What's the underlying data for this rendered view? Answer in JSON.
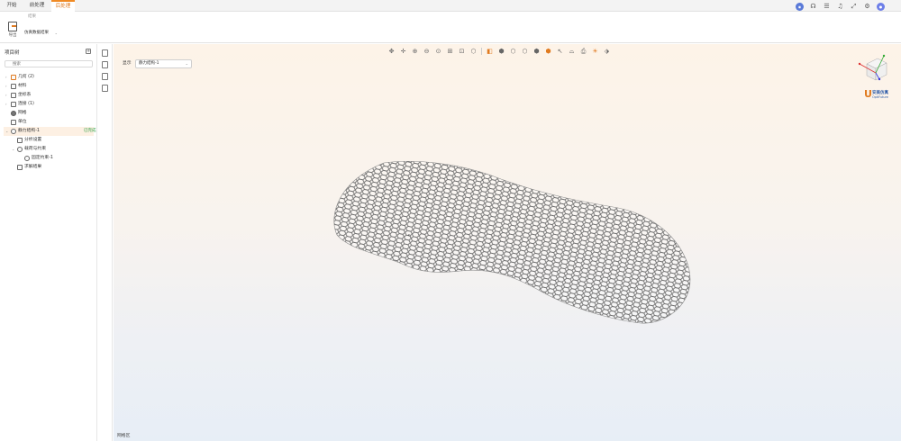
{
  "menu": {
    "tabs": [
      {
        "label": "开始",
        "active": false
      },
      {
        "label": "前处理",
        "active": false
      },
      {
        "label": "后处理",
        "active": true
      }
    ]
  },
  "top_icons": [
    "assistant-icon",
    "headset-icon",
    "list-icon",
    "bell-icon",
    "fullscreen-icon",
    "gear-icon",
    "avatar"
  ],
  "ribbon": {
    "group_label": "结果",
    "export_label": "导出",
    "select_value": "仿真数据结果"
  },
  "tree": {
    "title": "项目树",
    "search_placeholder": "搜索",
    "items": [
      {
        "label": "几何 (2)",
        "level": 0,
        "arrow": "›",
        "icon": "geometry-icon"
      },
      {
        "label": "材料",
        "level": 0,
        "arrow": "›",
        "icon": "material-icon"
      },
      {
        "label": "坐标系",
        "level": 0,
        "arrow": "›",
        "icon": "coordinate-icon"
      },
      {
        "label": "连接 (1)",
        "level": 0,
        "arrow": "›",
        "icon": "connection-icon"
      },
      {
        "label": "网格",
        "level": 0,
        "arrow": "",
        "icon": "mesh-icon"
      },
      {
        "label": "单位",
        "level": 0,
        "arrow": "",
        "icon": "unit-icon"
      },
      {
        "label": "静力结构-1",
        "level": 0,
        "arrow": "⌄",
        "icon": "structure-icon",
        "badge": "已完成",
        "selected": true
      },
      {
        "label": "分析设置",
        "level": 1,
        "arrow": "",
        "icon": "settings-icon"
      },
      {
        "label": "载荷与约束",
        "level": 1,
        "arrow": "⌄",
        "icon": "load-icon"
      },
      {
        "label": "固定约束-1",
        "level": 2,
        "arrow": "",
        "icon": "constraint-icon"
      },
      {
        "label": "求解结果",
        "level": 1,
        "arrow": "",
        "icon": "result-icon"
      }
    ]
  },
  "viewport": {
    "display_label": "显示",
    "display_value": "静力结构-1",
    "brand_name": "安美仿真",
    "brand_sub": "OptiFuture",
    "tools": [
      "rotate-icon",
      "pan-icon",
      "zoom-in-icon",
      "zoom-out-icon",
      "fit-icon",
      "box-zoom-icon",
      "frame-icon",
      "view-cube-icon",
      "front-view-icon",
      "top-view-icon",
      "left-view-icon",
      "right-view-icon",
      "iso-view-icon",
      "cursor-icon",
      "section-icon",
      "print-icon",
      "light-icon",
      "clip-icon"
    ]
  },
  "status": {
    "text": "网格区"
  }
}
